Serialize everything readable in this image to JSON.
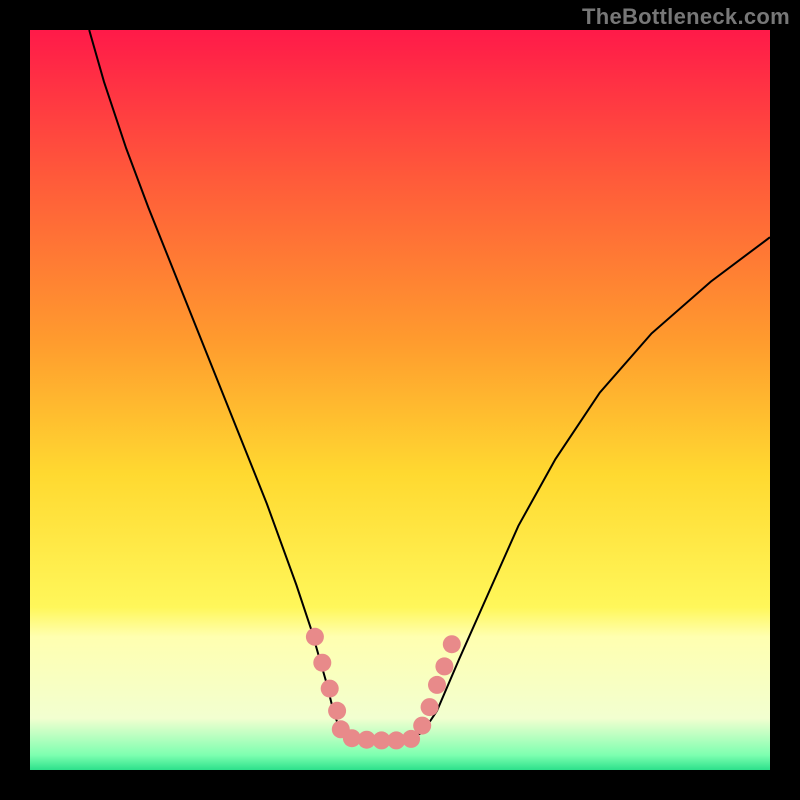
{
  "watermark": "TheBottleneck.com",
  "chart_data": {
    "type": "line",
    "title": "",
    "xlabel": "",
    "ylabel": "",
    "xlim": [
      0,
      100
    ],
    "ylim": [
      0,
      100
    ],
    "grid": false,
    "frame": {
      "pad_left": 30,
      "pad_right": 30,
      "pad_top": 30,
      "pad_bottom": 30
    },
    "background_gradient": {
      "top_color": "#ff1a49",
      "mid_color": "#ffe531",
      "bottom_color": "#2de08b",
      "stops": [
        {
          "offset": 0.0,
          "color": "#ff1a49"
        },
        {
          "offset": 0.2,
          "color": "#ff5a3a"
        },
        {
          "offset": 0.42,
          "color": "#ff9b2e"
        },
        {
          "offset": 0.6,
          "color": "#ffd930"
        },
        {
          "offset": 0.78,
          "color": "#fff75a"
        },
        {
          "offset": 0.82,
          "color": "#ffffb0"
        },
        {
          "offset": 0.93,
          "color": "#f2ffd0"
        },
        {
          "offset": 0.98,
          "color": "#7dffb0"
        },
        {
          "offset": 1.0,
          "color": "#2de08b"
        }
      ]
    },
    "series": [
      {
        "name": "bottleneck-curve",
        "stroke": "#000000",
        "stroke_width": 2,
        "x": [
          8,
          10,
          13,
          16,
          20,
          24,
          28,
          32,
          36,
          38,
          40,
          41,
          42,
          44,
          47,
          50,
          53,
          55,
          58,
          62,
          66,
          71,
          77,
          84,
          92,
          100
        ],
        "values": [
          100,
          93,
          84,
          76,
          66,
          56,
          46,
          36,
          25,
          19,
          12,
          8,
          5,
          4,
          4,
          4,
          5,
          8,
          15,
          24,
          33,
          42,
          51,
          59,
          66,
          72
        ]
      },
      {
        "name": "highlight-markers",
        "type": "scatter",
        "marker_color": "#e88a8a",
        "marker_radius": 9,
        "x": [
          38.5,
          39.5,
          40.5,
          41.5,
          42.0,
          43.5,
          45.5,
          47.5,
          49.5,
          51.5,
          53.0,
          54.0,
          55.0,
          56.0,
          57.0
        ],
        "values": [
          18.0,
          14.5,
          11.0,
          8.0,
          5.5,
          4.3,
          4.1,
          4.0,
          4.0,
          4.2,
          6.0,
          8.5,
          11.5,
          14.0,
          17.0
        ]
      }
    ]
  }
}
